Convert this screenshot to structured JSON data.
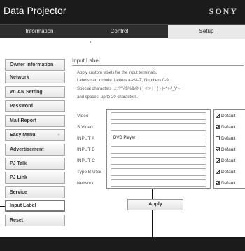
{
  "app": {
    "title": "Data Projector",
    "brand": "SONY"
  },
  "tabs": {
    "information": "Information",
    "control": "Control",
    "setup": "Setup"
  },
  "sidebar": {
    "items": [
      {
        "label": "Owner information"
      },
      {
        "label": "Network"
      },
      {
        "label": "WLAN Setting"
      },
      {
        "label": "Password"
      },
      {
        "label": "Mail Report"
      },
      {
        "label": "Easy Menu",
        "chevron": "»"
      },
      {
        "label": "Advertisement"
      },
      {
        "label": "PJ Talk"
      },
      {
        "label": "PJ Link"
      },
      {
        "label": "Service"
      },
      {
        "label": "Input Label",
        "active": true
      },
      {
        "label": "Reset"
      }
    ]
  },
  "section": {
    "title": "Input Label",
    "description": [
      "Apply custom labels for the input terminals.",
      "Labels can include: Letters a-z/A-Z, Numbers 0-9,",
      "Special characters .,:;!?'\"#$%&@ ( ) < > [ ] { } |=*+-/_\\^~",
      "and spaces, up to 20 characters."
    ]
  },
  "inputs": [
    {
      "label": "Video",
      "value": "",
      "default_label": "Default",
      "default_checked": true
    },
    {
      "label": "S Video",
      "value": "",
      "default_label": "Default",
      "default_checked": true
    },
    {
      "label": "INPUT A",
      "value": "DVD Player",
      "default_label": "Default",
      "default_checked": false
    },
    {
      "label": "INPUT B",
      "value": "",
      "default_label": "Default",
      "default_checked": true
    },
    {
      "label": "INPUT C",
      "value": "",
      "default_label": "Default",
      "default_checked": true
    },
    {
      "label": "Type B USB",
      "value": "",
      "default_label": "Default",
      "default_checked": true
    },
    {
      "label": "Network",
      "value": "",
      "default_label": "Default",
      "default_checked": true
    }
  ],
  "apply_label": "Apply"
}
